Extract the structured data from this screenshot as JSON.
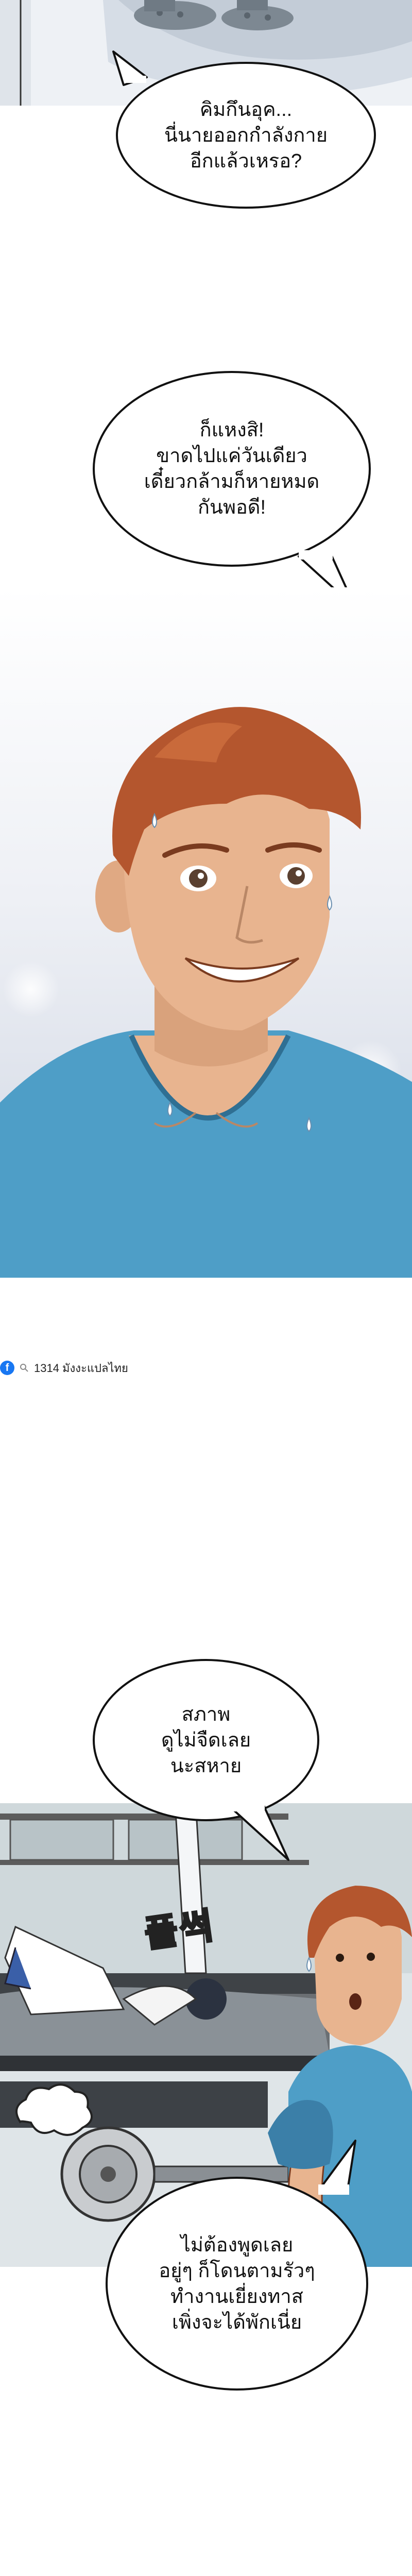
{
  "bubbles": {
    "b1": {
      "lines": [
        "คิมกึนอุค...",
        "นี่นายออกกำลังกาย",
        "อีกแล้วเหรอ?"
      ]
    },
    "b2": {
      "lines": [
        "ก็แหงสิ!",
        "ขาดไปแค่วันเดียว",
        "เดี๋ยวกล้ามก็หายหมด",
        "กันพอดี!"
      ]
    },
    "b3": {
      "lines": [
        "สภาพ",
        "ดูไม่จืดเลย",
        "นะสหาย"
      ]
    },
    "b4": {
      "lines": [
        "ไม่ต้องพูดเลย",
        "อยู่ๆ ก็โดนตามรัวๆ",
        "ทำงานเยี่ยงทาส",
        "เพิ่งจะได้พักเนี่ย"
      ]
    }
  },
  "credit": {
    "text": "1314 มังงะแปลไทย"
  },
  "sfx": {
    "text": "풀썩"
  },
  "colors": {
    "shirt": "#4e9ec7",
    "hair": "#b4562e",
    "skin": "#e8b48f",
    "facebook": "#1877f2"
  },
  "icons": [
    "facebook-icon",
    "search-icon"
  ]
}
